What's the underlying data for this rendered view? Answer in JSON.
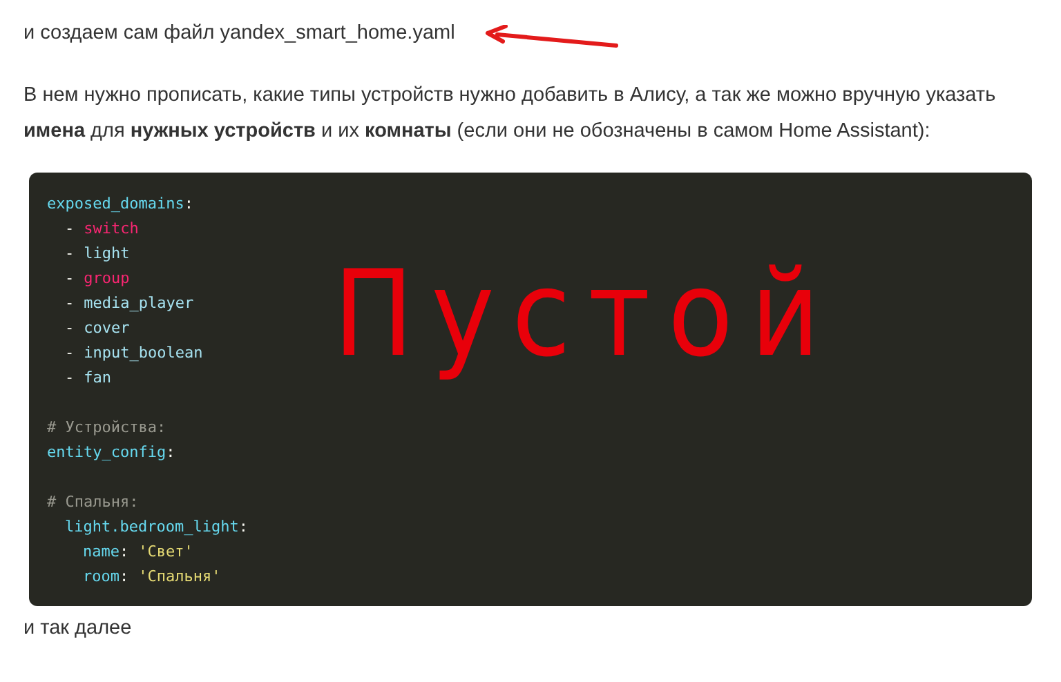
{
  "intro": "и создаем сам файл yandex_smart_home.yaml",
  "paragraph": "В нем нужно прописать, какие типы устройств нужно добавить в Алису, а так же можно вручную указать **имена** для **нужных устройств** и их **комнаты** (если они не обозначены в самом Home Assistant):",
  "code_blocks": [
    [
      {
        "tokens": [
          {
            "kind": "key",
            "text": "exposed_domains"
          },
          {
            "kind": "punct",
            "text": ":"
          }
        ],
        "children": [
          {
            "tokens": [
              {
                "kind": "punct",
                "text": "-"
              },
              {
                "kind": "keyword",
                "text": "switch"
              }
            ]
          },
          {
            "tokens": [
              {
                "kind": "punct",
                "text": "-"
              },
              {
                "kind": "item",
                "text": "light"
              }
            ]
          },
          {
            "tokens": [
              {
                "kind": "punct",
                "text": "-"
              },
              {
                "kind": "keyword",
                "text": "group"
              }
            ]
          },
          {
            "tokens": [
              {
                "kind": "punct",
                "text": "-"
              },
              {
                "kind": "item",
                "text": "media_player"
              }
            ]
          },
          {
            "tokens": [
              {
                "kind": "punct",
                "text": "-"
              },
              {
                "kind": "item",
                "text": "cover"
              }
            ]
          },
          {
            "tokens": [
              {
                "kind": "punct",
                "text": "-"
              },
              {
                "kind": "item",
                "text": "input_boolean"
              }
            ]
          },
          {
            "tokens": [
              {
                "kind": "punct",
                "text": "-"
              },
              {
                "kind": "item",
                "text": "fan"
              }
            ]
          }
        ]
      }
    ],
    [
      {
        "tokens": [
          {
            "kind": "comment",
            "text": "# Устройства:"
          }
        ]
      },
      {
        "tokens": [
          {
            "kind": "key",
            "text": "entity_config"
          },
          {
            "kind": "punct",
            "text": ":"
          }
        ]
      }
    ],
    [
      {
        "tokens": [
          {
            "kind": "comment",
            "text": "# Спальня:"
          }
        ],
        "children": [
          {
            "tokens": [
              {
                "kind": "key",
                "text": "light.bedroom_light"
              },
              {
                "kind": "punct",
                "text": ":"
              }
            ],
            "children": [
              {
                "tokens": [
                  {
                    "kind": "key",
                    "text": "name"
                  },
                  {
                    "kind": "punct",
                    "text": ":"
                  },
                  {
                    "kind": "string",
                    "text": "'Свет'"
                  }
                ]
              },
              {
                "tokens": [
                  {
                    "kind": "key",
                    "text": "room"
                  },
                  {
                    "kind": "punct",
                    "text": ":"
                  },
                  {
                    "kind": "string",
                    "text": "'Спальня'"
                  }
                ]
              }
            ]
          }
        ]
      }
    ]
  ],
  "annotation": "Пустой",
  "outro": "и так далее"
}
